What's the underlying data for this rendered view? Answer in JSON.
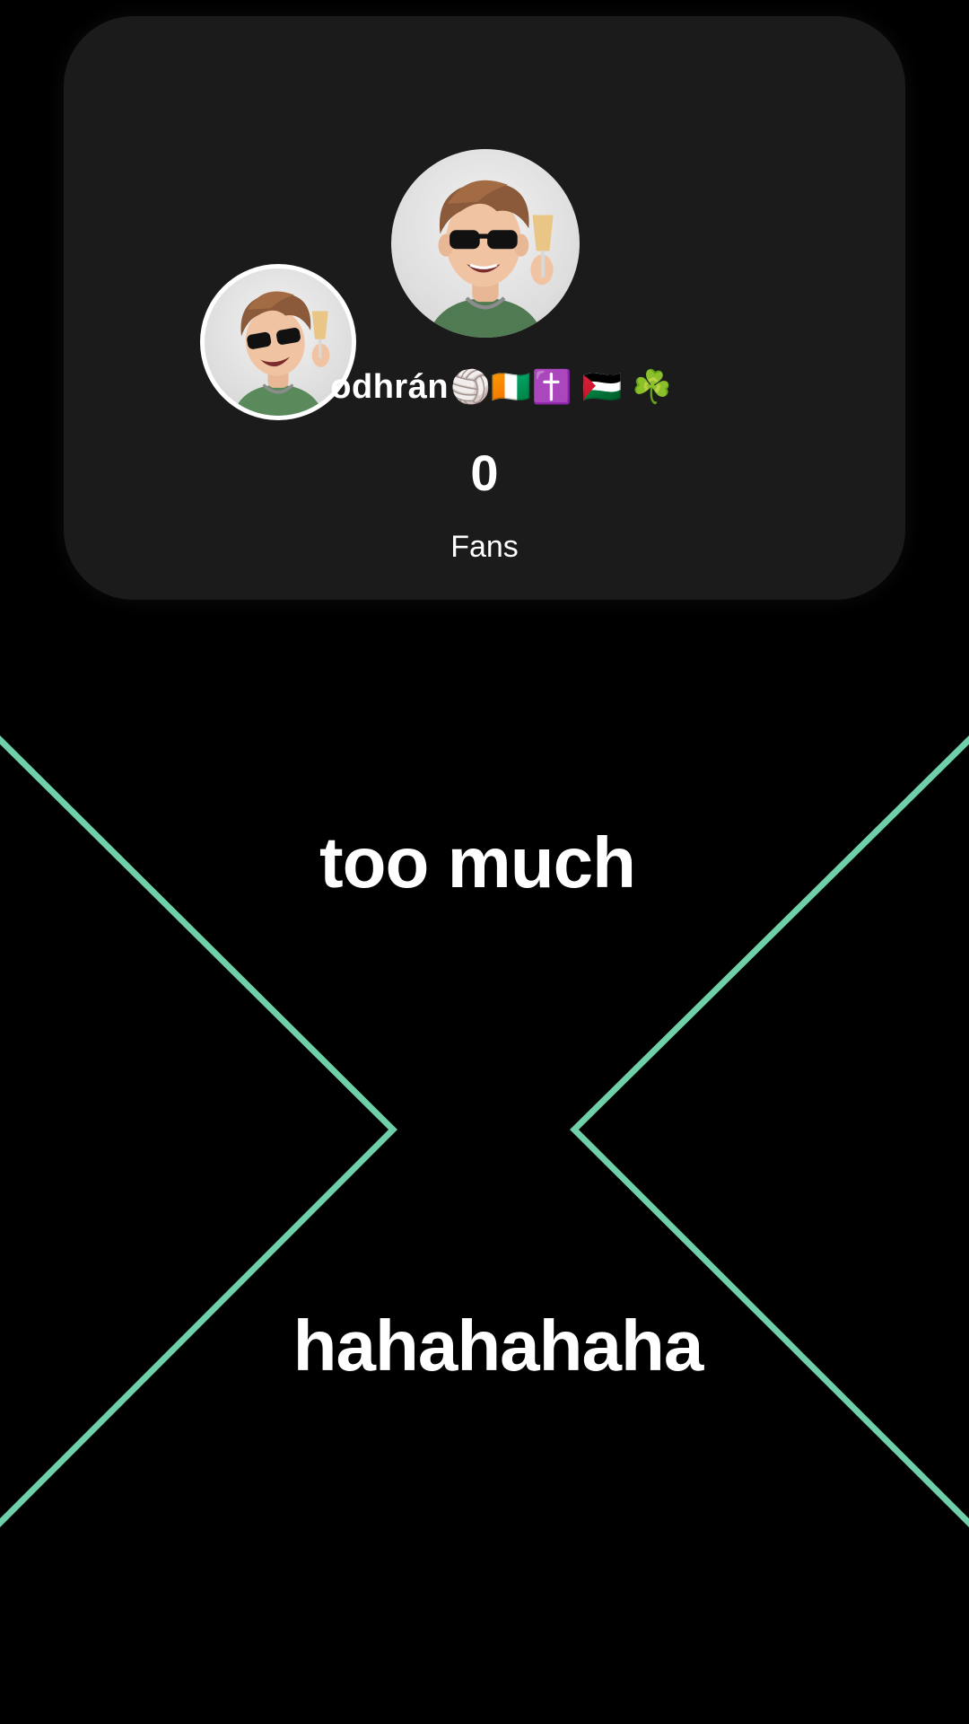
{
  "profile": {
    "display_name": "odhrán",
    "name_emojis": "🏐🇨🇮✝️ 🇵🇸 ☘️",
    "fans_count": "0",
    "fans_label": "Fans"
  },
  "captions": {
    "top": "too much",
    "bottom": "hahahahaha"
  },
  "colors": {
    "background": "#000000",
    "card": "#1b1b1b",
    "accent_line": "#6fcfa8",
    "text": "#ffffff"
  },
  "icons": {
    "main_avatar": "cartoon-avatar-sunglasses-champagne",
    "small_avatar": "cartoon-avatar-sunglasses-champagne"
  }
}
